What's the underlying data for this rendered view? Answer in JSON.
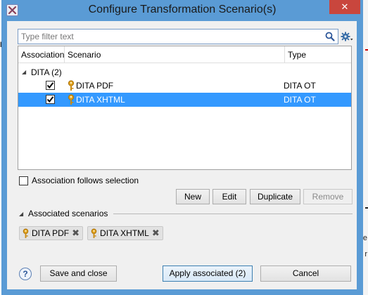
{
  "window": {
    "title": "Configure Transformation Scenario(s)",
    "close_glyph": "✕"
  },
  "filter": {
    "placeholder": "Type filter text"
  },
  "table": {
    "columns": [
      "Association",
      "Scenario",
      "Type"
    ],
    "group": {
      "label": "DITA (2)",
      "expanded": true
    },
    "rows": [
      {
        "checked": true,
        "scenario": "DITA PDF",
        "type": "DITA OT",
        "selected": false
      },
      {
        "checked": true,
        "scenario": "DITA XHTML",
        "type": "DITA OT",
        "selected": true
      }
    ]
  },
  "association_follows_selection": {
    "label": "Association follows selection",
    "checked": false
  },
  "actions": {
    "new": "New",
    "edit": "Edit",
    "duplicate": "Duplicate",
    "remove": "Remove"
  },
  "associated": {
    "label": "Associated scenarios",
    "chips": [
      "DITA PDF",
      "DITA XHTML"
    ]
  },
  "footer": {
    "help_glyph": "?",
    "save_close": "Save and close",
    "apply": "Apply associated (2)",
    "cancel": "Cancel"
  },
  "colors": {
    "title_bar": "#5a9bd5",
    "selection": "#3399ff",
    "close_button": "#c9463d"
  },
  "icons": {
    "app": "oxygen-app-icon",
    "search": "search-icon",
    "settings": "gear-icon",
    "scenario": "key-icon",
    "remove_chip": "close-x-icon"
  }
}
